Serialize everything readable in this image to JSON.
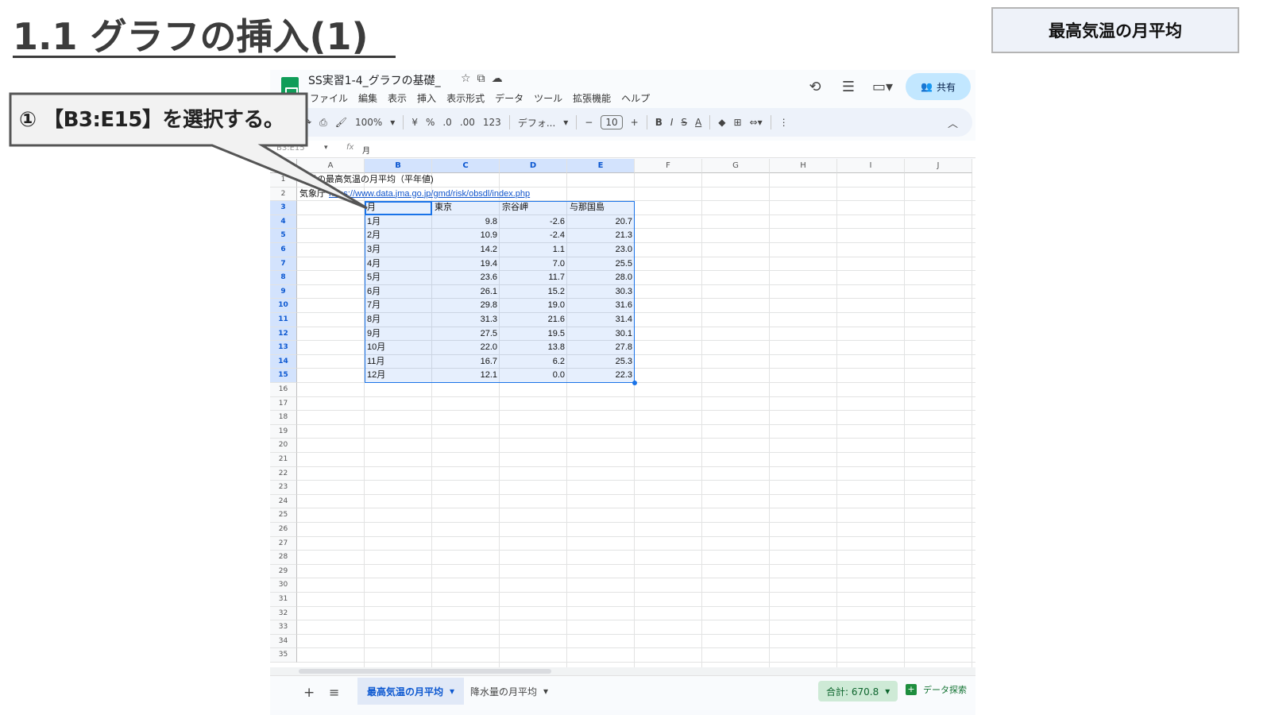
{
  "slide": {
    "title": "1.1 グラフの挿入(1)",
    "badge": "最高気温の月平均"
  },
  "callout": {
    "text": "① 【B3:E15】を選択する。"
  },
  "app": {
    "doc_title": "SS実習1-4_グラフの基礎_",
    "title_icons": [
      "star-icon",
      "move-folder-icon",
      "cloud-status-icon"
    ],
    "menu": [
      "ファイル",
      "編集",
      "表示",
      "挿入",
      "表示形式",
      "データ",
      "ツール",
      "拡張機能",
      "ヘルプ"
    ],
    "share_label": "共有"
  },
  "toolbar": {
    "zoom": "100%",
    "currency": "¥",
    "percent": "%",
    "dec_less": ".0",
    "dec_more": ".00",
    "number_format": "123",
    "font": "デフォ...",
    "font_size": "10",
    "bold": "B",
    "italic": "I",
    "strike": "S",
    "text_color": "A"
  },
  "formula_bar": {
    "name_box": "B3:E15",
    "fx": "fx",
    "value": "月"
  },
  "grid": {
    "columns": [
      "A",
      "B",
      "C",
      "D",
      "E",
      "F",
      "G",
      "H",
      "I",
      "J"
    ],
    "selected_columns": [
      "B",
      "C",
      "D",
      "E"
    ],
    "rows_visible": 35,
    "selected_rows": [
      3,
      4,
      5,
      6,
      7,
      8,
      9,
      10,
      11,
      12,
      13,
      14,
      15
    ],
    "a1_text": "日の最高気温の月平均（平年値)",
    "a2_label": "気象庁",
    "a2_link": "https://www.data.jma.go.jp/gmd/risk/obsdl/index.php",
    "table_header": [
      "月",
      "東京",
      "宗谷岬",
      "与那国島"
    ],
    "table_rows": [
      [
        "1月",
        "9.8",
        "-2.6",
        "20.7"
      ],
      [
        "2月",
        "10.9",
        "-2.4",
        "21.3"
      ],
      [
        "3月",
        "14.2",
        "1.1",
        "23.0"
      ],
      [
        "4月",
        "19.4",
        "7.0",
        "25.5"
      ],
      [
        "5月",
        "23.6",
        "11.7",
        "28.0"
      ],
      [
        "6月",
        "26.1",
        "15.2",
        "30.3"
      ],
      [
        "7月",
        "29.8",
        "19.0",
        "31.6"
      ],
      [
        "8月",
        "31.3",
        "21.6",
        "31.4"
      ],
      [
        "9月",
        "27.5",
        "19.5",
        "30.1"
      ],
      [
        "10月",
        "22.0",
        "13.8",
        "27.8"
      ],
      [
        "11月",
        "16.7",
        "6.2",
        "25.3"
      ],
      [
        "12月",
        "12.1",
        "0.0",
        "22.3"
      ]
    ]
  },
  "sheetbar": {
    "add": "+",
    "list": "≡",
    "active_tab": "最高気温の月平均",
    "other_tab": "降水量の月平均",
    "sum": "合計: 670.8",
    "explore": "データ探索"
  },
  "colors": {
    "accent": "#1a73e8",
    "selection_fill": "#e8f0fe",
    "share": "#c2e7ff",
    "sum_badge": "#ceead6"
  }
}
